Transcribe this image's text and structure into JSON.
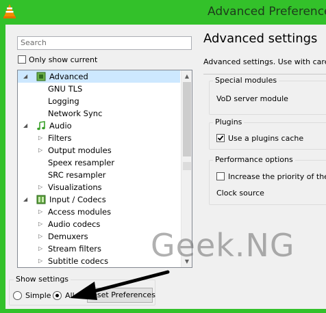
{
  "window": {
    "title": "Advanced Preferences"
  },
  "search": {
    "placeholder": "Search"
  },
  "only_show_current": {
    "label": "Only show current",
    "checked": false
  },
  "tree": {
    "items": [
      {
        "label": "Advanced",
        "level": 0,
        "expanded": true,
        "icon": "advanced-chip-icon",
        "selected": true
      },
      {
        "label": "GNU TLS",
        "level": 1
      },
      {
        "label": "Logging",
        "level": 1
      },
      {
        "label": "Network Sync",
        "level": 1
      },
      {
        "label": "Audio",
        "level": 0,
        "expanded": true,
        "icon": "music-note-icon"
      },
      {
        "label": "Filters",
        "level": 1,
        "collapsed": true
      },
      {
        "label": "Output modules",
        "level": 1,
        "collapsed": true
      },
      {
        "label": "Speex resampler",
        "level": 1
      },
      {
        "label": "SRC resampler",
        "level": 1
      },
      {
        "label": "Visualizations",
        "level": 1,
        "collapsed": true
      },
      {
        "label": "Input / Codecs",
        "level": 0,
        "expanded": true,
        "icon": "codec-icon"
      },
      {
        "label": "Access modules",
        "level": 1,
        "collapsed": true
      },
      {
        "label": "Audio codecs",
        "level": 1,
        "collapsed": true
      },
      {
        "label": "Demuxers",
        "level": 1,
        "collapsed": true
      },
      {
        "label": "Stream filters",
        "level": 1,
        "collapsed": true
      },
      {
        "label": "Subtitle codecs",
        "level": 1,
        "collapsed": true
      }
    ]
  },
  "show_settings": {
    "group_label": "Show settings",
    "simple_label": "Simple",
    "all_label": "All",
    "selected": "All"
  },
  "reset_button": {
    "label": "Reset Preferences"
  },
  "panel": {
    "heading": "Advanced settings",
    "subtitle": "Advanced settings. Use with care...",
    "special_modules": {
      "group_label": "Special modules",
      "field_label": "VoD server module"
    },
    "plugins": {
      "group_label": "Plugins",
      "use_cache_label": "Use a plugins cache",
      "use_cache_checked": true
    },
    "performance": {
      "group_label": "Performance options",
      "priority_label": "Increase the priority of the process",
      "priority_checked": false,
      "clock_label": "Clock source"
    }
  },
  "watermark": {
    "text": "Geek.NG"
  },
  "colors": {
    "frame": "#33c12a",
    "selection": "#cde8ff",
    "client": "#f0f0f0"
  }
}
